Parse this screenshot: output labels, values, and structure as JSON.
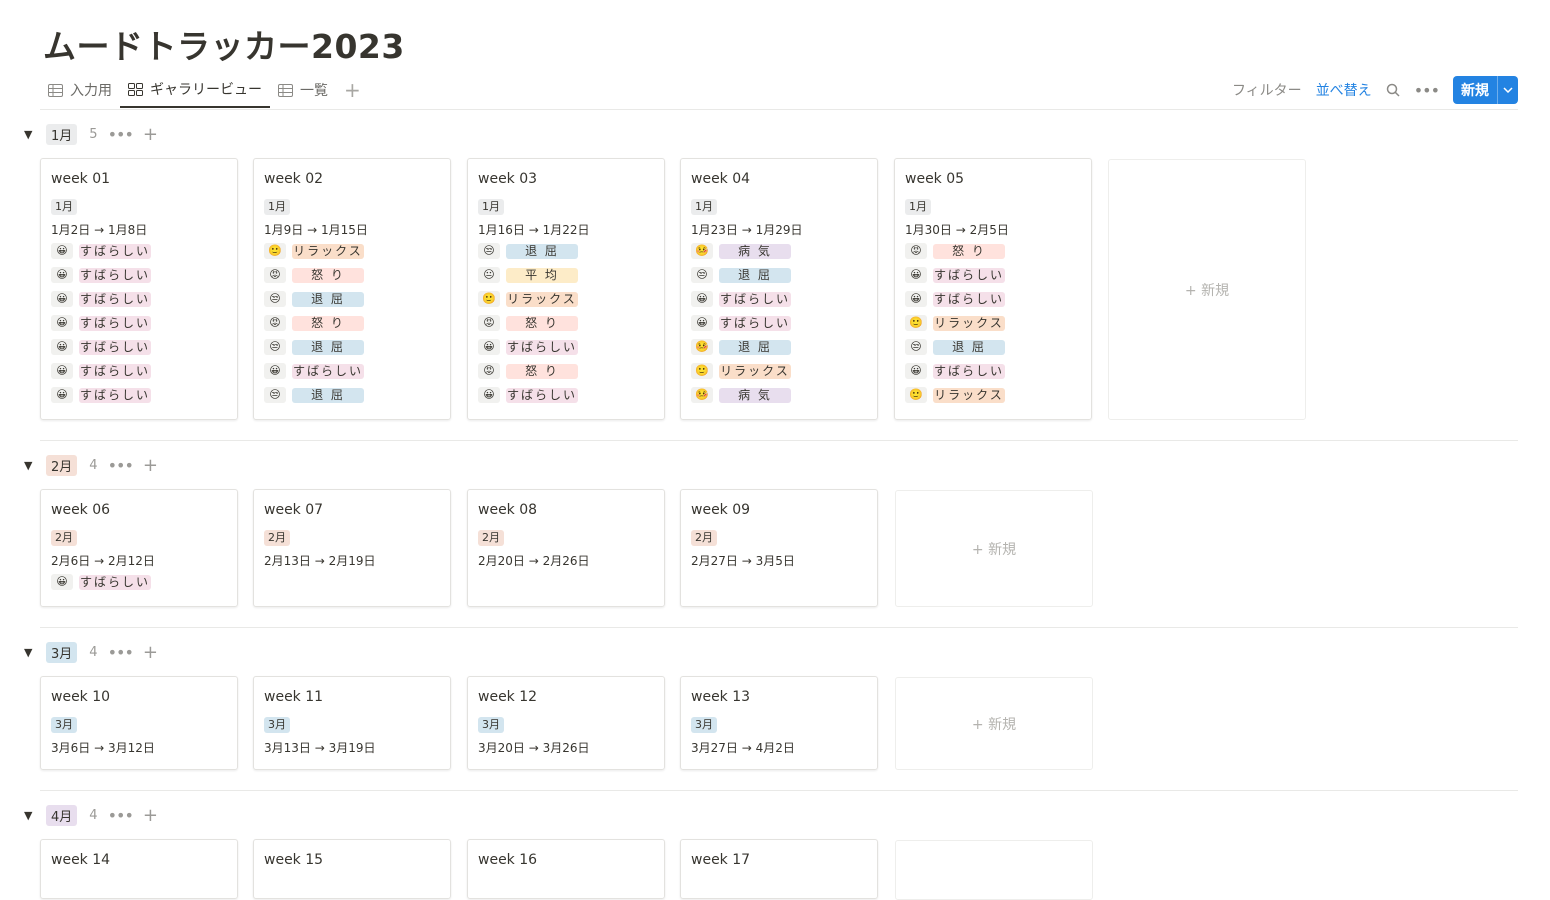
{
  "title": "ムードトラッカー2023",
  "tabs": [
    {
      "label": "入力用",
      "icon": "table-icon"
    },
    {
      "label": "ギャラリービュー",
      "icon": "gallery-icon"
    },
    {
      "label": "一覧",
      "icon": "table-icon"
    }
  ],
  "toolbar": {
    "filter": "フィルター",
    "sort": "並べ替え",
    "new": "新規"
  },
  "colors": {
    "jan_tag": "#ebeced",
    "feb_tag": "#f5e0d7",
    "mar_tag": "#d3e5ef",
    "apr_tag": "#e8deee",
    "great": "#f5e0e9",
    "relax": "#fadec9",
    "anger": "#ffe2dd",
    "bored": "#d3e5ef",
    "average": "#fdecc8",
    "sick": "#e8deee",
    "accent": "#2383e2"
  },
  "groups": [
    {
      "label": "1月",
      "count": "5"
    },
    {
      "label": "2月",
      "count": "4"
    },
    {
      "label": "3月",
      "count": "4"
    },
    {
      "label": "4月",
      "count": "4"
    }
  ],
  "new_label": "新規",
  "cards": [
    {
      "title": "week 01",
      "month": "1月",
      "range": "1月2日 → 1月8日",
      "moods": [
        [
          "😀",
          "すばらしい"
        ],
        [
          "😀",
          "すばらしい"
        ],
        [
          "😀",
          "すばらしい"
        ],
        [
          "😀",
          "すばらしい"
        ],
        [
          "😀",
          "すばらしい"
        ],
        [
          "😀",
          "すばらしい"
        ],
        [
          "😀",
          "すばらしい"
        ]
      ]
    },
    {
      "title": "week 02",
      "month": "1月",
      "range": "1月9日 → 1月15日",
      "moods": [
        [
          "🙂",
          "リラックス"
        ],
        [
          "😡",
          "怒 り"
        ],
        [
          "😒",
          "退 屈"
        ],
        [
          "😡",
          "怒 り"
        ],
        [
          "😒",
          "退 屈"
        ],
        [
          "😀",
          "すばらしい"
        ],
        [
          "😒",
          "退 屈"
        ]
      ]
    },
    {
      "title": "week 03",
      "month": "1月",
      "range": "1月16日 → 1月22日",
      "moods": [
        [
          "😒",
          "退 屈"
        ],
        [
          "😐",
          "平 均"
        ],
        [
          "🙂",
          "リラックス"
        ],
        [
          "😡",
          "怒 り"
        ],
        [
          "😀",
          "すばらしい"
        ],
        [
          "😡",
          "怒 り"
        ],
        [
          "😀",
          "すばらしい"
        ]
      ]
    },
    {
      "title": "week 04",
      "month": "1月",
      "range": "1月23日 → 1月29日",
      "moods": [
        [
          "🤒",
          "病 気"
        ],
        [
          "😒",
          "退 屈"
        ],
        [
          "😀",
          "すばらしい"
        ],
        [
          "😀",
          "すばらしい"
        ],
        [
          "🤒",
          "退 屈"
        ],
        [
          "🙂",
          "リラックス"
        ],
        [
          "🤒",
          "病 気"
        ]
      ]
    },
    {
      "title": "week 05",
      "month": "1月",
      "range": "1月30日 → 2月5日",
      "moods": [
        [
          "😡",
          "怒 り"
        ],
        [
          "😀",
          "すばらしい"
        ],
        [
          "😀",
          "すばらしい"
        ],
        [
          "🙂",
          "リラックス"
        ],
        [
          "😒",
          "退 屈"
        ],
        [
          "😀",
          "すばらしい"
        ],
        [
          "🙂",
          "リラックス"
        ]
      ]
    },
    {
      "title": "week 06",
      "month": "2月",
      "range": "2月6日 → 2月12日",
      "moods": [
        [
          "😀",
          "すばらしい"
        ]
      ]
    },
    {
      "title": "week 07",
      "month": "2月",
      "range": "2月13日 → 2月19日",
      "moods": []
    },
    {
      "title": "week 08",
      "month": "2月",
      "range": "2月20日 → 2月26日",
      "moods": []
    },
    {
      "title": "week 09",
      "month": "2月",
      "range": "2月27日 → 3月5日",
      "moods": []
    },
    {
      "title": "week 10",
      "month": "3月",
      "range": "3月6日 → 3月12日",
      "moods": []
    },
    {
      "title": "week 11",
      "month": "3月",
      "range": "3月13日 → 3月19日",
      "moods": []
    },
    {
      "title": "week 12",
      "month": "3月",
      "range": "3月20日 → 3月26日",
      "moods": []
    },
    {
      "title": "week 13",
      "month": "3月",
      "range": "3月27日 → 4月2日",
      "moods": []
    },
    {
      "title": "week 14"
    },
    {
      "title": "week 15"
    },
    {
      "title": "week 16"
    },
    {
      "title": "week 17"
    }
  ]
}
